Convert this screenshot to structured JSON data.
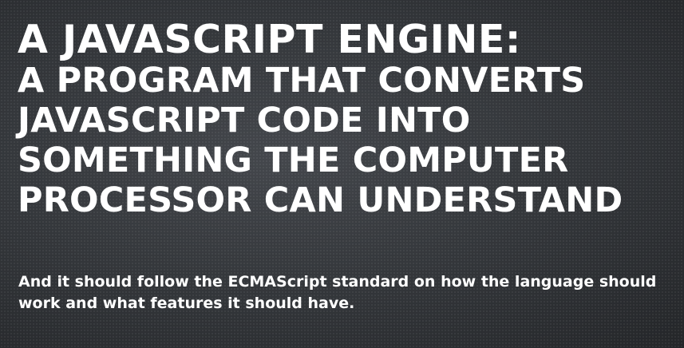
{
  "slide": {
    "title_line1": "A JAVASCRIPT ENGINE:",
    "title_rest": "A PROGRAM THAT CONVERTS JAVASCRIPT CODE INTO SOMETHING THE COMPUTER PROCESSOR CAN UNDERSTAND",
    "body": "And it should follow the ECMAScript standard on how the language should work and what features it should have."
  }
}
